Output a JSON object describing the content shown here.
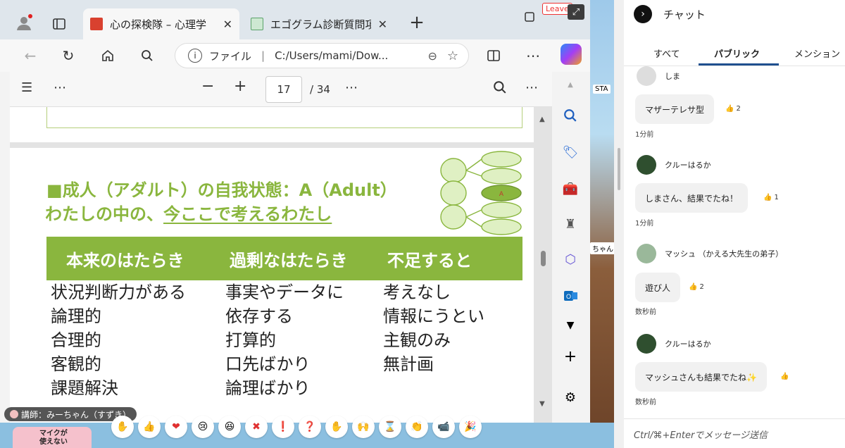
{
  "browser": {
    "tabs": [
      {
        "title": "心の探検隊 – 心理学",
        "active": true
      },
      {
        "title": "エゴグラム診断質問項",
        "active": false
      }
    ],
    "leave_label": "Leave",
    "address": {
      "prefix": "ファイル",
      "url": "C:/Users/mami/Dow..."
    },
    "pdf": {
      "current_page": "17",
      "total_pages": "/ 34"
    }
  },
  "slide": {
    "heading_marker": "■",
    "heading_line1": "成人（アダルト）の自我状態：A（Adult）",
    "heading_line2_prefix": "わたしの中の、",
    "heading_line2_underlined": "今ここで考えるわたし",
    "diagram_label": "A",
    "table": {
      "headers": [
        "本来のはたらき",
        "過剰なはたらき",
        "不足すると"
      ],
      "columns": [
        [
          "状況判断力がある",
          "論理的",
          "合理的",
          "客観的",
          "課題解決"
        ],
        [
          "事実やデータに",
          "依存する",
          "打算的",
          "口先ばかり",
          "論理ばかり"
        ],
        [
          "考えなし",
          "情報にうとい",
          "主観のみ",
          "無計画"
        ]
      ]
    }
  },
  "side": {
    "sta_tag": "STA",
    "chan_tag": "ちゃん"
  },
  "bottom": {
    "lecturer": "講師：みーちゃん（すずき）",
    "mic": "マイクが\n使えない",
    "reactions": [
      "✋",
      "👍",
      "❤",
      "😢",
      "😆",
      "✖",
      "❗",
      "❓",
      "✋",
      "🙌",
      "⌛",
      "👏",
      "📹",
      "🎉"
    ]
  },
  "chat": {
    "title": "チャット",
    "tabs": [
      "すべて",
      "パブリック",
      "メンション"
    ],
    "messages": [
      {
        "user": "しま",
        "text": "マザーテレサ型",
        "likes": "2",
        "time": "1分前"
      },
      {
        "user": "クルーはるか",
        "text": "しまさん、結果でたね！",
        "likes": "1",
        "time": "1分前"
      },
      {
        "user": "マッシュ （かえる大先生の弟子）",
        "text": "遊び人",
        "likes": "2",
        "time": "数秒前"
      },
      {
        "user": "クルーはるか",
        "text": "マッシュさんも結果でたね✨",
        "likes": "",
        "time": "数秒前"
      }
    ],
    "input_placeholder": "Ctrl/⌘+Enterでメッセージ送信"
  }
}
